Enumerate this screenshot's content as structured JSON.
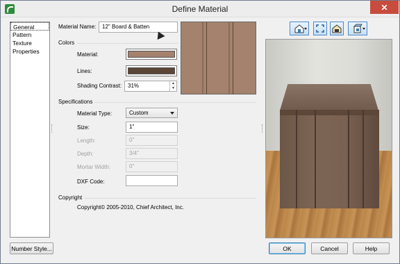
{
  "window": {
    "title": "Define Material",
    "close_glyph": "✕"
  },
  "nav": {
    "items": [
      "General",
      "Pattern",
      "Texture",
      "Properties"
    ],
    "selected": "General"
  },
  "material_name": {
    "label": "Material Name:",
    "value": "12\" Board & Batten"
  },
  "colors": {
    "section": "Colors",
    "material_label": "Material:",
    "material_color": "#a4826d",
    "lines_label": "Lines:",
    "lines_color": "#5b4536",
    "shading_label": "Shading Contrast:",
    "shading_value": "31%"
  },
  "specifications": {
    "section": "Specifications",
    "material_type_label": "Material Type:",
    "material_type_value": "Custom",
    "size_label": "Size:",
    "size_value": "1\"",
    "length_label": "Length:",
    "length_value": "0\"",
    "depth_label": "Depth:",
    "depth_value": "3/4\"",
    "mortar_label": "Mortar Width:",
    "mortar_value": "0\"",
    "dxf_label": "DXF Code:",
    "dxf_value": ""
  },
  "copyright": {
    "section": "Copyright",
    "text": "Copyright© 2005-2010, Chief Architect, Inc."
  },
  "toolbar": {
    "icons": [
      "view-house-icon",
      "fit-window-icon",
      "camera-house-icon",
      "render-mode-icon"
    ]
  },
  "buttons": {
    "number_style": "Number Style...",
    "ok": "OK",
    "cancel": "Cancel",
    "help": "Help"
  }
}
